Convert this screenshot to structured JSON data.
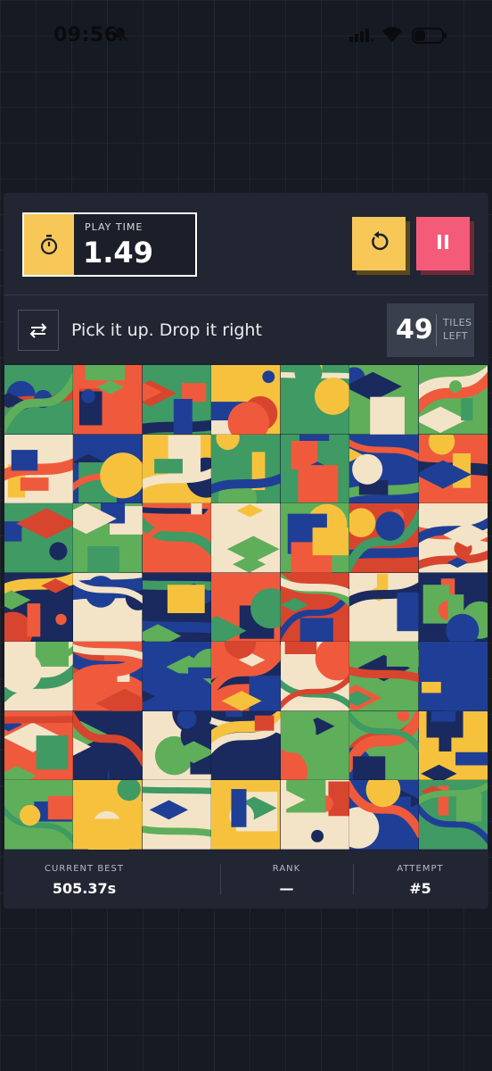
{
  "status_bar": {
    "time": "09:56",
    "icons": [
      "bell-muted-icon",
      "signal-icon",
      "wifi-icon",
      "battery-icon"
    ]
  },
  "header": {
    "timer_label": "PLAY TIME",
    "timer_value": "1.49",
    "timer_icon": "stopwatch-icon",
    "restart_icon": "restart-icon",
    "pause_icon": "pause-icon"
  },
  "hint": {
    "icon": "swap-arrows-icon",
    "text": "Pick it up. Drop it right"
  },
  "tiles_left": {
    "count": "49",
    "label_top": "TILES",
    "label_bottom": "LEFT"
  },
  "board": {
    "columns": 7,
    "rows": 7,
    "palette": [
      "#1f3f96",
      "#ef5a3c",
      "#f6c23e",
      "#3f9a63",
      "#f3e4c8",
      "#1a2a5e",
      "#d8452f",
      "#5fae5a"
    ]
  },
  "stats": [
    {
      "label": "CURRENT BEST",
      "value": "505.37s"
    },
    {
      "label": "RANK",
      "value": "—"
    },
    {
      "label": "ATTEMPT",
      "value": "#5"
    }
  ],
  "colors": {
    "accent_yellow": "#f7c858",
    "accent_pink": "#f45b78",
    "panel": "#222632",
    "background": "#161a22"
  }
}
